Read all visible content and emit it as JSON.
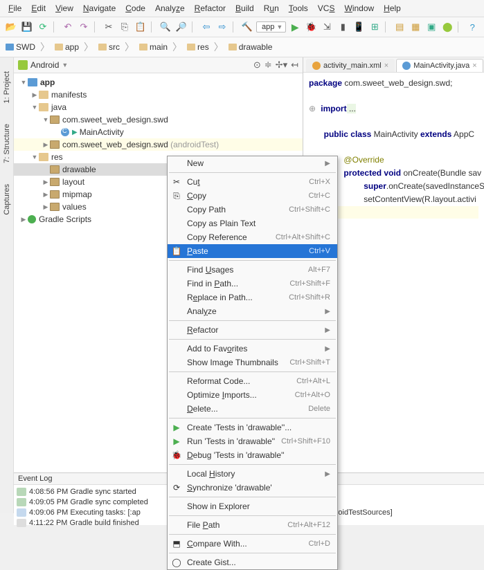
{
  "menu": [
    "File",
    "Edit",
    "View",
    "Navigate",
    "Code",
    "Analyze",
    "Refactor",
    "Build",
    "Run",
    "Tools",
    "VCS",
    "Window",
    "Help"
  ],
  "module_selector": "app",
  "breadcrumb": [
    "SWD",
    "app",
    "src",
    "main",
    "res",
    "drawable"
  ],
  "project_panel": {
    "title": "Android",
    "tree": {
      "app": "app",
      "manifests": "manifests",
      "java": "java",
      "pkg1": "com.sweet_web_design.swd",
      "mainactivity": "MainActivity",
      "pkg2": "com.sweet_web_design.swd",
      "pkg2_suffix": "(androidTest)",
      "res": "res",
      "drawable": "drawable",
      "layout": "layout",
      "mipmap": "mipmap",
      "values": "values",
      "gradle": "Gradle Scripts"
    }
  },
  "editor_tabs": {
    "tab1": "activity_main.xml",
    "tab2": "MainActivity.java"
  },
  "code": {
    "l1_a": "package",
    "l1_b": " com.sweet_web_design.swd;",
    "l2_a": "import",
    "l2_b": " ...",
    "l3_a": "public class",
    "l3_b": " MainActivity ",
    "l3_c": "extends",
    "l3_d": " AppC",
    "l4": "@Override",
    "l5_a": "protected void",
    "l5_b": " onCreate(Bundle sav",
    "l6_a": "super",
    "l6_b": ".onCreate(savedInstanceSt",
    "l7": "setContentView(R.layout.activi",
    "l8": "}"
  },
  "context_menu": [
    {
      "label": "New",
      "sub": true
    },
    {
      "sep": true
    },
    {
      "label": "Cut",
      "icon": "✂",
      "shortcut": "Ctrl+X",
      "u": true,
      "upos": 2
    },
    {
      "label": "Copy",
      "icon": "⎘",
      "shortcut": "Ctrl+C",
      "u": true,
      "upos": 0
    },
    {
      "label": "Copy Path",
      "shortcut": "Ctrl+Shift+C"
    },
    {
      "label": "Copy as Plain Text"
    },
    {
      "label": "Copy Reference",
      "shortcut": "Ctrl+Alt+Shift+C"
    },
    {
      "label": "Paste",
      "icon": "📋",
      "shortcut": "Ctrl+V",
      "selected": true,
      "u": true,
      "upos": 0
    },
    {
      "sep": true
    },
    {
      "label": "Find Usages",
      "shortcut": "Alt+F7",
      "u": true,
      "upos": 5
    },
    {
      "label": "Find in Path...",
      "shortcut": "Ctrl+Shift+F",
      "u": true,
      "upos": 8
    },
    {
      "label": "Replace in Path...",
      "shortcut": "Ctrl+Shift+R",
      "u": true,
      "upos": 1
    },
    {
      "label": "Analyze",
      "sub": true,
      "u": true,
      "upos": 4
    },
    {
      "sep": true
    },
    {
      "label": "Refactor",
      "sub": true,
      "u": true,
      "upos": 0
    },
    {
      "sep": true
    },
    {
      "label": "Add to Favorites",
      "sub": true,
      "u": true,
      "upos": 10
    },
    {
      "label": "Show Image Thumbnails",
      "shortcut": "Ctrl+Shift+T"
    },
    {
      "sep": true
    },
    {
      "label": "Reformat Code...",
      "shortcut": "Ctrl+Alt+L"
    },
    {
      "label": "Optimize Imports...",
      "shortcut": "Ctrl+Alt+O",
      "u": true,
      "upos": 9
    },
    {
      "label": "Delete...",
      "shortcut": "Delete",
      "u": true,
      "upos": 0
    },
    {
      "sep": true
    },
    {
      "label": "Create 'Tests in 'drawable''...",
      "icon": "▶",
      "iconcolor": "#4caf50"
    },
    {
      "label": "Run 'Tests in 'drawable''",
      "icon": "▶",
      "iconcolor": "#4caf50",
      "shortcut": "Ctrl+Shift+F10"
    },
    {
      "label": "Debug 'Tests in 'drawable''",
      "icon": "🐞",
      "iconcolor": "#2e7d32",
      "u": true,
      "upos": 0
    },
    {
      "sep": true
    },
    {
      "label": "Local History",
      "sub": true,
      "u": true,
      "upos": 6
    },
    {
      "label": "Synchronize 'drawable'",
      "icon": "⟳",
      "u": true,
      "upos": 0
    },
    {
      "sep": true
    },
    {
      "label": "Show in Explorer"
    },
    {
      "sep": true
    },
    {
      "label": "File Path",
      "shortcut": "Ctrl+Alt+F12",
      "u": true,
      "upos": 5
    },
    {
      "sep": true
    },
    {
      "label": "Compare With...",
      "icon": "⬒",
      "shortcut": "Ctrl+D",
      "u": true,
      "upos": 0
    },
    {
      "sep": true
    },
    {
      "label": "Create Gist...",
      "icon": "◯"
    }
  ],
  "sidetabs": {
    "project": "1: Project",
    "structure": "7: Structure",
    "captures": "Captures"
  },
  "event_log": {
    "title": "Event Log",
    "rows": [
      {
        "icon": "info",
        "t": "4:08:56 PM Gradle sync started"
      },
      {
        "icon": "info",
        "t": "4:09:05 PM Gradle sync completed"
      },
      {
        "icon": "talk",
        "t": "4:09:06 PM Executing tasks: [:ap",
        "tail": "ougAndroidTestSources]"
      },
      {
        "icon": "sys",
        "t": "4:11:22 PM Gradle build finished"
      }
    ]
  }
}
